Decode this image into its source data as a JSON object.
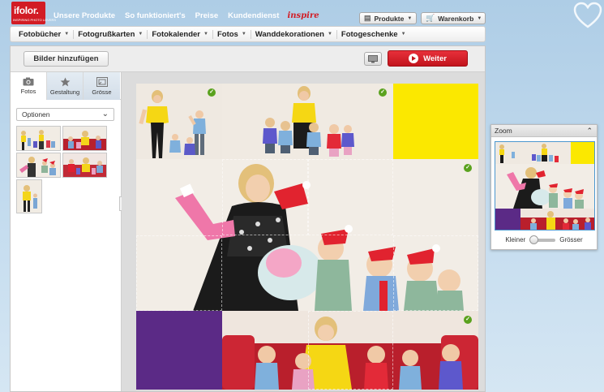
{
  "brand": {
    "name": "ifolor.",
    "tagline": "INSPIRING PHOTO LOVERS",
    "color": "#d21c24"
  },
  "top_nav": {
    "items": [
      "Unsere Produkte",
      "So funktioniert's",
      "Preise",
      "Kundendienst"
    ],
    "inspire": "inspire",
    "produkte_label": "Produkte",
    "warenkorb_label": "Warenkorb"
  },
  "categories": [
    "Fotobücher",
    "Fotogrußkarten",
    "Fotokalender",
    "Fotos",
    "Wanddekorationen",
    "Fotogeschenke"
  ],
  "toolbar": {
    "add_label": "Bilder hinzufügen",
    "next_label": "Weiter",
    "next_color": "#d21c24"
  },
  "side_panel": {
    "tabs": [
      {
        "label": "Fotos",
        "icon": "camera-icon",
        "active": true
      },
      {
        "label": "Gestaltung",
        "icon": "star-icon",
        "active": false
      },
      {
        "label": "Grösse",
        "icon": "resize-icon",
        "active": false
      }
    ],
    "options_label": "Optionen",
    "thumbnail_count": 5,
    "collapse_glyph": "»"
  },
  "canvas": {
    "filler_yellow": "#fbe800",
    "filler_purple": "#5b2a86"
  },
  "zoom": {
    "title": "Zoom",
    "smaller_label": "Kleiner",
    "bigger_label": "Grösser",
    "level": 0
  }
}
